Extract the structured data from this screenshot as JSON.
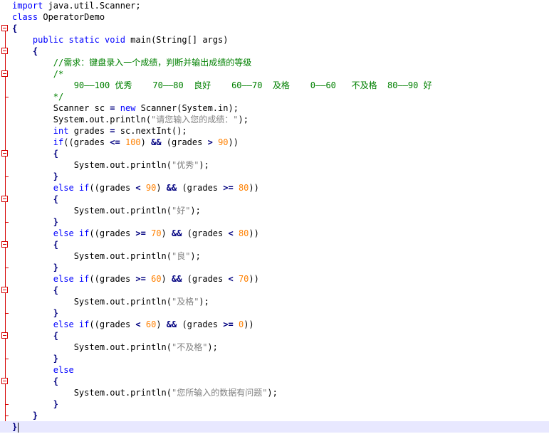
{
  "editor": {
    "language": "Java",
    "colors": {
      "keyword": "#0000ff",
      "comment": "#008000",
      "number": "#ff8000",
      "string": "#808080",
      "operator": "#000080",
      "fold_marker": "#d60000",
      "current_line": "#e8e8ff"
    },
    "lines": [
      [
        {
          "t": "import",
          "c": "kw"
        },
        {
          "t": " java.util.Scanner;"
        }
      ],
      [
        {
          "t": "class",
          "c": "kw"
        },
        {
          "t": " OperatorDemo"
        }
      ],
      [
        {
          "t": "{",
          "c": "op"
        }
      ],
      [
        {
          "t": "    "
        },
        {
          "t": "public static void",
          "c": "kw"
        },
        {
          "t": " main(String[] args)"
        }
      ],
      [
        {
          "t": "    "
        },
        {
          "t": "{",
          "c": "op"
        }
      ],
      [
        {
          "t": "        "
        },
        {
          "t": "//需求：键盘录入一个成绩，判断并输出成绩的等级",
          "c": "cm"
        }
      ],
      [
        {
          "t": "        "
        },
        {
          "t": "/*",
          "c": "cm"
        }
      ],
      [
        {
          "t": "            90——100 优秀    70——80  良好    60——70  及格    0——60   不及格  80——90 好",
          "c": "cm"
        }
      ],
      [
        {
          "t": "        "
        },
        {
          "t": "*/",
          "c": "cm"
        }
      ],
      [
        {
          "t": "        Scanner sc "
        },
        {
          "t": "=",
          "c": "op"
        },
        {
          "t": " "
        },
        {
          "t": "new",
          "c": "kw"
        },
        {
          "t": " Scanner(System.in);"
        }
      ],
      [
        {
          "t": "        System.out.println("
        },
        {
          "t": "\"请您输入您的成绩：\"",
          "c": "str"
        },
        {
          "t": ");"
        }
      ],
      [
        {
          "t": "        "
        },
        {
          "t": "int",
          "c": "kw"
        },
        {
          "t": " grades "
        },
        {
          "t": "=",
          "c": "op"
        },
        {
          "t": " sc.nextInt();"
        }
      ],
      [
        {
          "t": "        "
        },
        {
          "t": "if",
          "c": "kw"
        },
        {
          "t": "((grades "
        },
        {
          "t": "<=",
          "c": "op"
        },
        {
          "t": " "
        },
        {
          "t": "100",
          "c": "num"
        },
        {
          "t": ") "
        },
        {
          "t": "&&",
          "c": "op"
        },
        {
          "t": " (grades "
        },
        {
          "t": ">",
          "c": "op"
        },
        {
          "t": " "
        },
        {
          "t": "90",
          "c": "num"
        },
        {
          "t": "))"
        }
      ],
      [
        {
          "t": "        "
        },
        {
          "t": "{",
          "c": "op"
        }
      ],
      [
        {
          "t": "            System.out.println("
        },
        {
          "t": "\"优秀\"",
          "c": "str"
        },
        {
          "t": ");"
        }
      ],
      [
        {
          "t": "        "
        },
        {
          "t": "}",
          "c": "op"
        }
      ],
      [
        {
          "t": "        "
        },
        {
          "t": "else if",
          "c": "kw"
        },
        {
          "t": "((grades "
        },
        {
          "t": "<",
          "c": "op"
        },
        {
          "t": " "
        },
        {
          "t": "90",
          "c": "num"
        },
        {
          "t": ") "
        },
        {
          "t": "&&",
          "c": "op"
        },
        {
          "t": " (grades "
        },
        {
          "t": ">=",
          "c": "op"
        },
        {
          "t": " "
        },
        {
          "t": "80",
          "c": "num"
        },
        {
          "t": "))"
        }
      ],
      [
        {
          "t": "        "
        },
        {
          "t": "{",
          "c": "op"
        }
      ],
      [
        {
          "t": "            System.out.println("
        },
        {
          "t": "\"好\"",
          "c": "str"
        },
        {
          "t": ");"
        }
      ],
      [
        {
          "t": "        "
        },
        {
          "t": "}",
          "c": "op"
        }
      ],
      [
        {
          "t": "        "
        },
        {
          "t": "else if",
          "c": "kw"
        },
        {
          "t": "((grades "
        },
        {
          "t": ">=",
          "c": "op"
        },
        {
          "t": " "
        },
        {
          "t": "70",
          "c": "num"
        },
        {
          "t": ") "
        },
        {
          "t": "&&",
          "c": "op"
        },
        {
          "t": " (grades "
        },
        {
          "t": "<",
          "c": "op"
        },
        {
          "t": " "
        },
        {
          "t": "80",
          "c": "num"
        },
        {
          "t": "))"
        }
      ],
      [
        {
          "t": "        "
        },
        {
          "t": "{",
          "c": "op"
        }
      ],
      [
        {
          "t": "            System.out.println("
        },
        {
          "t": "\"良\"",
          "c": "str"
        },
        {
          "t": ");"
        }
      ],
      [
        {
          "t": "        "
        },
        {
          "t": "}",
          "c": "op"
        }
      ],
      [
        {
          "t": "        "
        },
        {
          "t": "else if",
          "c": "kw"
        },
        {
          "t": "((grades "
        },
        {
          "t": ">=",
          "c": "op"
        },
        {
          "t": " "
        },
        {
          "t": "60",
          "c": "num"
        },
        {
          "t": ") "
        },
        {
          "t": "&&",
          "c": "op"
        },
        {
          "t": " (grades "
        },
        {
          "t": "<",
          "c": "op"
        },
        {
          "t": " "
        },
        {
          "t": "70",
          "c": "num"
        },
        {
          "t": "))"
        }
      ],
      [
        {
          "t": "        "
        },
        {
          "t": "{",
          "c": "op"
        }
      ],
      [
        {
          "t": "            System.out.println("
        },
        {
          "t": "\"及格\"",
          "c": "str"
        },
        {
          "t": ");"
        }
      ],
      [
        {
          "t": "        "
        },
        {
          "t": "}",
          "c": "op"
        }
      ],
      [
        {
          "t": "        "
        },
        {
          "t": "else if",
          "c": "kw"
        },
        {
          "t": "((grades "
        },
        {
          "t": "<",
          "c": "op"
        },
        {
          "t": " "
        },
        {
          "t": "60",
          "c": "num"
        },
        {
          "t": ") "
        },
        {
          "t": "&&",
          "c": "op"
        },
        {
          "t": " (grades "
        },
        {
          "t": ">=",
          "c": "op"
        },
        {
          "t": " "
        },
        {
          "t": "0",
          "c": "num"
        },
        {
          "t": "))"
        }
      ],
      [
        {
          "t": "        "
        },
        {
          "t": "{",
          "c": "op"
        }
      ],
      [
        {
          "t": "            System.out.println("
        },
        {
          "t": "\"不及格\"",
          "c": "str"
        },
        {
          "t": ");"
        }
      ],
      [
        {
          "t": "        "
        },
        {
          "t": "}",
          "c": "op"
        }
      ],
      [
        {
          "t": "        "
        },
        {
          "t": "else",
          "c": "kw"
        }
      ],
      [
        {
          "t": "        "
        },
        {
          "t": "{",
          "c": "op"
        }
      ],
      [
        {
          "t": "            System.out.println("
        },
        {
          "t": "\"您所输入的数据有问题\"",
          "c": "str"
        },
        {
          "t": ");"
        }
      ],
      [
        {
          "t": "        "
        },
        {
          "t": "}",
          "c": "op"
        }
      ],
      [
        {
          "t": "    "
        },
        {
          "t": "}",
          "c": "op"
        }
      ],
      [
        {
          "t": "}",
          "c": "op"
        }
      ]
    ]
  }
}
